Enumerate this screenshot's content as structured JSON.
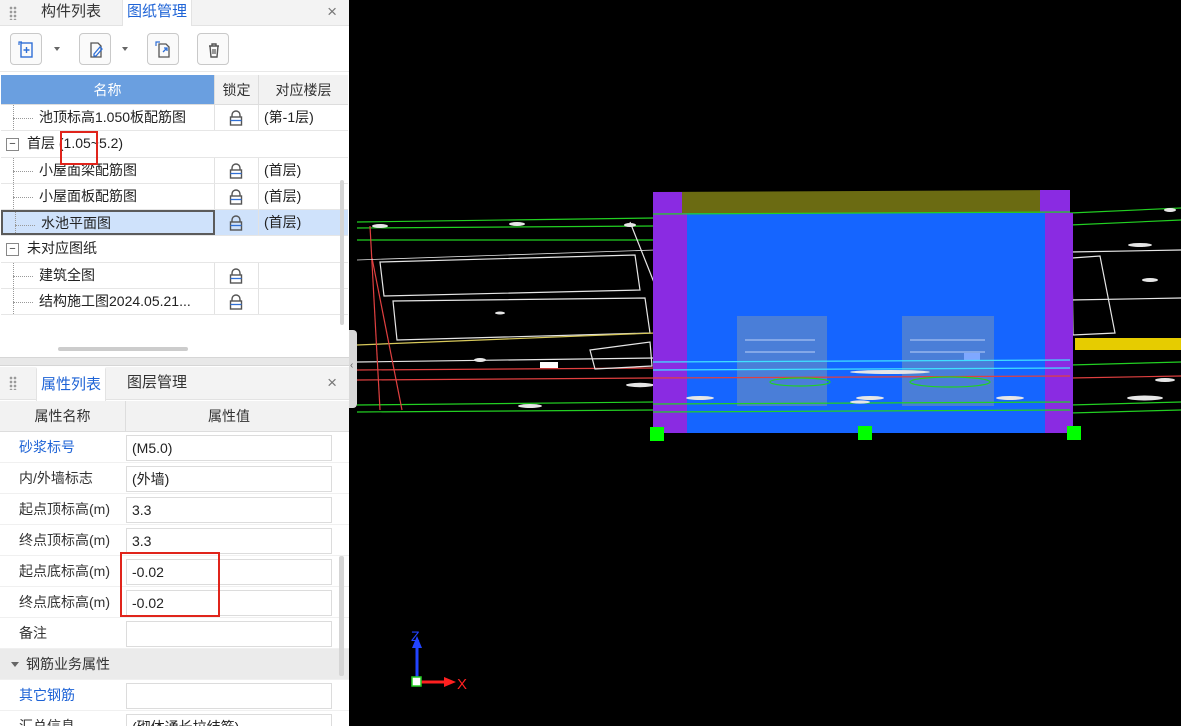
{
  "top_panel": {
    "tabs": [
      "构件列表",
      "图纸管理"
    ],
    "active_tab": 1,
    "close": "×"
  },
  "drawings": {
    "headers": {
      "name": "名称",
      "lock": "锁定",
      "floor": "对应楼层"
    },
    "rows": [
      {
        "kind": "leaf",
        "name": "池顶标高1.050板配筋图",
        "floor": "(第-1层)"
      },
      {
        "kind": "group",
        "name": "首层 (1.05~5.2)",
        "toggle": "−"
      },
      {
        "kind": "leaf",
        "name": "小屋面梁配筋图",
        "floor": "(首层)"
      },
      {
        "kind": "leaf",
        "name": "小屋面板配筋图",
        "floor": "(首层)"
      },
      {
        "kind": "leaf",
        "name": "水池平面图",
        "floor": "(首层)",
        "selected": true
      },
      {
        "kind": "group",
        "name": "未对应图纸",
        "toggle": "−"
      },
      {
        "kind": "leaf",
        "name": "建筑全图",
        "floor": ""
      },
      {
        "kind": "leaf",
        "name": "结构施工图2024.05.21...",
        "floor": ""
      }
    ]
  },
  "bottom_panel": {
    "tabs": [
      "属性列表",
      "图层管理"
    ],
    "active_tab": 0,
    "close": "×"
  },
  "properties": {
    "headers": {
      "name": "属性名称",
      "value": "属性值"
    },
    "rows": [
      {
        "name": "砂浆标号",
        "value": "(M5.0)",
        "blue": true
      },
      {
        "name": "内/外墙标志",
        "value": "(外墙)"
      },
      {
        "name": "起点顶标高(m)",
        "value": "3.3"
      },
      {
        "name": "终点顶标高(m)",
        "value": "3.3"
      },
      {
        "name": "起点底标高(m)",
        "value": "-0.02"
      },
      {
        "name": "终点底标高(m)",
        "value": "-0.02"
      },
      {
        "name": "备注",
        "value": ""
      },
      {
        "name": "钢筋业务属性",
        "section": true
      },
      {
        "name": "其它钢筋",
        "value": "",
        "blue": true
      },
      {
        "name": "汇总信息",
        "value": "(砌体通长拉结筋)"
      }
    ]
  },
  "axes": {
    "z": "Z",
    "x": "X"
  },
  "colors": {
    "accent": "#1e63d6",
    "header_blue": "#6a9fe0",
    "highlight_red": "#e0241b",
    "wall_blue": "#1565ff",
    "wall_purple": "#8a2be2",
    "wall_top": "#6b6b12",
    "cad_green": "#22d022",
    "handle_green": "#00ff00"
  }
}
